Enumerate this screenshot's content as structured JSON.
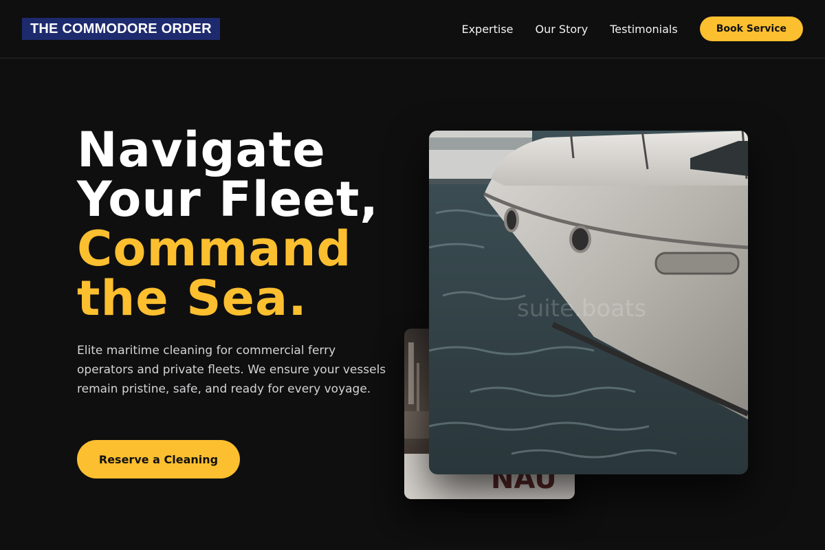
{
  "header": {
    "logo": "THE COMMODORE ORDER",
    "nav": [
      {
        "label": "Expertise"
      },
      {
        "label": "Our Story"
      },
      {
        "label": "Testimonials"
      }
    ],
    "cta_label": "Book Service"
  },
  "hero": {
    "title_line1": "Navigate",
    "title_line2": "Your Fleet,",
    "title_line3": "Command",
    "title_line4": "the Sea.",
    "description": "Elite maritime cleaning for commercial ferry operators and private fleets. We ensure your vessels remain pristine, safe, and ready for every voyage.",
    "cta_label": "Reserve a Cleaning"
  },
  "images": {
    "main_watermark": "suite.boats",
    "back_hull_text": "NAU"
  },
  "colors": {
    "background": "#0f0f10",
    "accent": "#fbbf2f",
    "logo_bg": "#1e2a6e"
  }
}
